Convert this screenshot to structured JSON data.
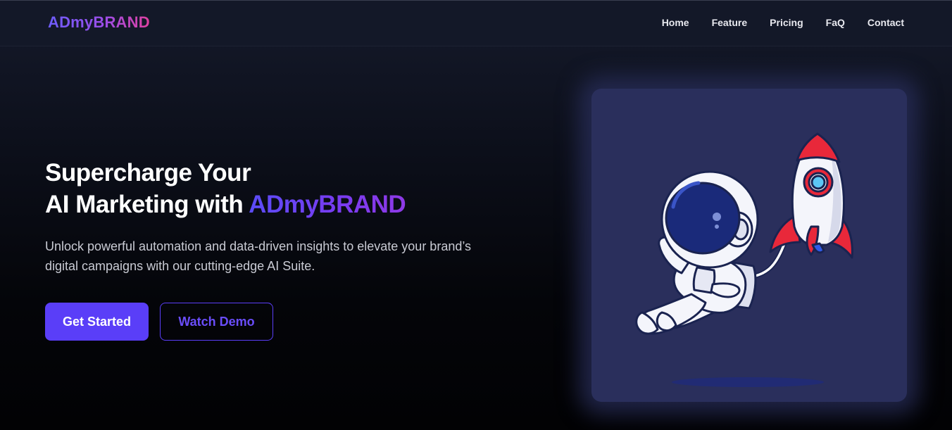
{
  "nav": {
    "logo": "ADmyBRAND",
    "links": [
      "Home",
      "Feature",
      "Pricing",
      "FaQ",
      "Contact"
    ]
  },
  "hero": {
    "headline_line1": "Supercharge Your",
    "headline_line2_prefix": "AI Marketing with ",
    "headline_brand": "ADmyBRAND",
    "subtext_line1": "Unlock powerful automation and data-driven insights to elevate your brand’s",
    "subtext_line2": "digital campaigns with our cutting-edge AI Suite.",
    "primary_button": "Get Started",
    "secondary_button": "Watch Demo"
  },
  "illustration": {
    "subject": "astronaut-with-rocket",
    "colors": {
      "card_bg": "#2a2f5c",
      "visor": "#1a2a7a",
      "suit": "#f4f5fb",
      "rocket_red": "#e8283a",
      "window_blue": "#5cc8f5"
    }
  },
  "colors": {
    "accent": "#5a3ef8",
    "logo_gradient_start": "#6d5dfc",
    "logo_gradient_end": "#e040a0"
  }
}
